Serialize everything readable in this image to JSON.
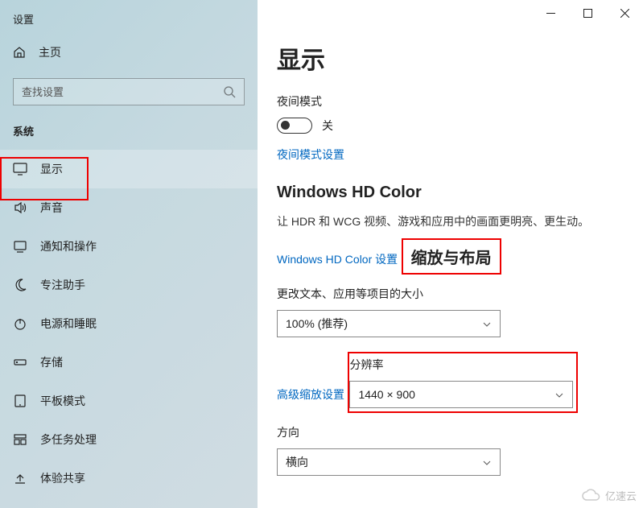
{
  "app_title": "设置",
  "home": {
    "label": "主页"
  },
  "search": {
    "placeholder": "查找设置"
  },
  "section_label": "系统",
  "nav": [
    {
      "label": "显示",
      "icon": "monitor-icon",
      "selected": true
    },
    {
      "label": "声音",
      "icon": "sound-icon"
    },
    {
      "label": "通知和操作",
      "icon": "notification-icon"
    },
    {
      "label": "专注助手",
      "icon": "moon-icon"
    },
    {
      "label": "电源和睡眠",
      "icon": "power-icon"
    },
    {
      "label": "存储",
      "icon": "storage-icon"
    },
    {
      "label": "平板模式",
      "icon": "tablet-icon"
    },
    {
      "label": "多任务处理",
      "icon": "multitask-icon"
    },
    {
      "label": "体验共享",
      "icon": "share-icon"
    }
  ],
  "page": {
    "title": "显示",
    "night_mode": {
      "label": "夜间模式",
      "state": "关",
      "link": "夜间模式设置"
    },
    "hd_color": {
      "title": "Windows HD Color",
      "desc": "让 HDR 和 WCG 视频、游戏和应用中的画面更明亮、更生动。",
      "link": "Windows HD Color 设置"
    },
    "scale": {
      "title": "缩放与布局",
      "label": "更改文本、应用等项目的大小",
      "value": "100% (推荐)",
      "link": "高级缩放设置"
    },
    "resolution": {
      "label": "分辨率",
      "value": "1440 × 900"
    },
    "orientation": {
      "label": "方向",
      "value": "横向"
    }
  },
  "watermark": "亿速云"
}
